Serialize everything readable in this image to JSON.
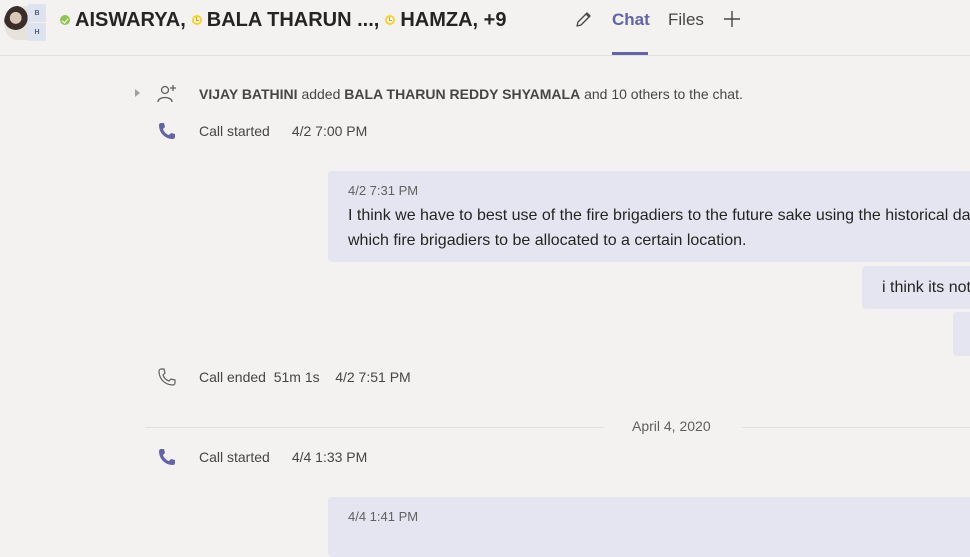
{
  "header": {
    "participants": [
      {
        "name": "AISWARYA,",
        "status": "available"
      },
      {
        "name": "BALA THARUN ...,",
        "status": "away"
      },
      {
        "name": "HAMZA, +9",
        "status": "away"
      }
    ],
    "avatar_initials": [
      "B",
      "H"
    ],
    "tabs": [
      {
        "label": "Chat",
        "active": true
      },
      {
        "label": "Files",
        "active": false
      }
    ],
    "edit_icon": "pencil-icon",
    "add_tab_icon": "plus-icon"
  },
  "events": {
    "added": {
      "actor": "VIJAY BATHINI",
      "verb": "added",
      "target": "BALA THARUN REDDY SHYAMALA",
      "rest": "and 10 others to the chat."
    },
    "call1": {
      "label": "Call started",
      "time": "4/2 7:00 PM"
    },
    "call_end": {
      "label": "Call ended",
      "duration": "51m 1s",
      "time": "4/2 7:51 PM"
    },
    "call2": {
      "label": "Call started",
      "time": "4/4 1:33 PM"
    }
  },
  "messages": [
    {
      "timestamp": "4/2 7:31 PM",
      "line1": "I think we have to best use of the fire brigadiers to the future sake using the historical data",
      "line2": "which fire brigadiers to be allocated to a certain location."
    },
    {
      "text": "i think its not"
    },
    {
      "timestamp": "4/4 1:41 PM"
    }
  ],
  "date_divider": "April 4, 2020",
  "colors": {
    "accent": "#6264a7",
    "bubble": "#e5e5f1",
    "background": "#f3f2f1"
  }
}
